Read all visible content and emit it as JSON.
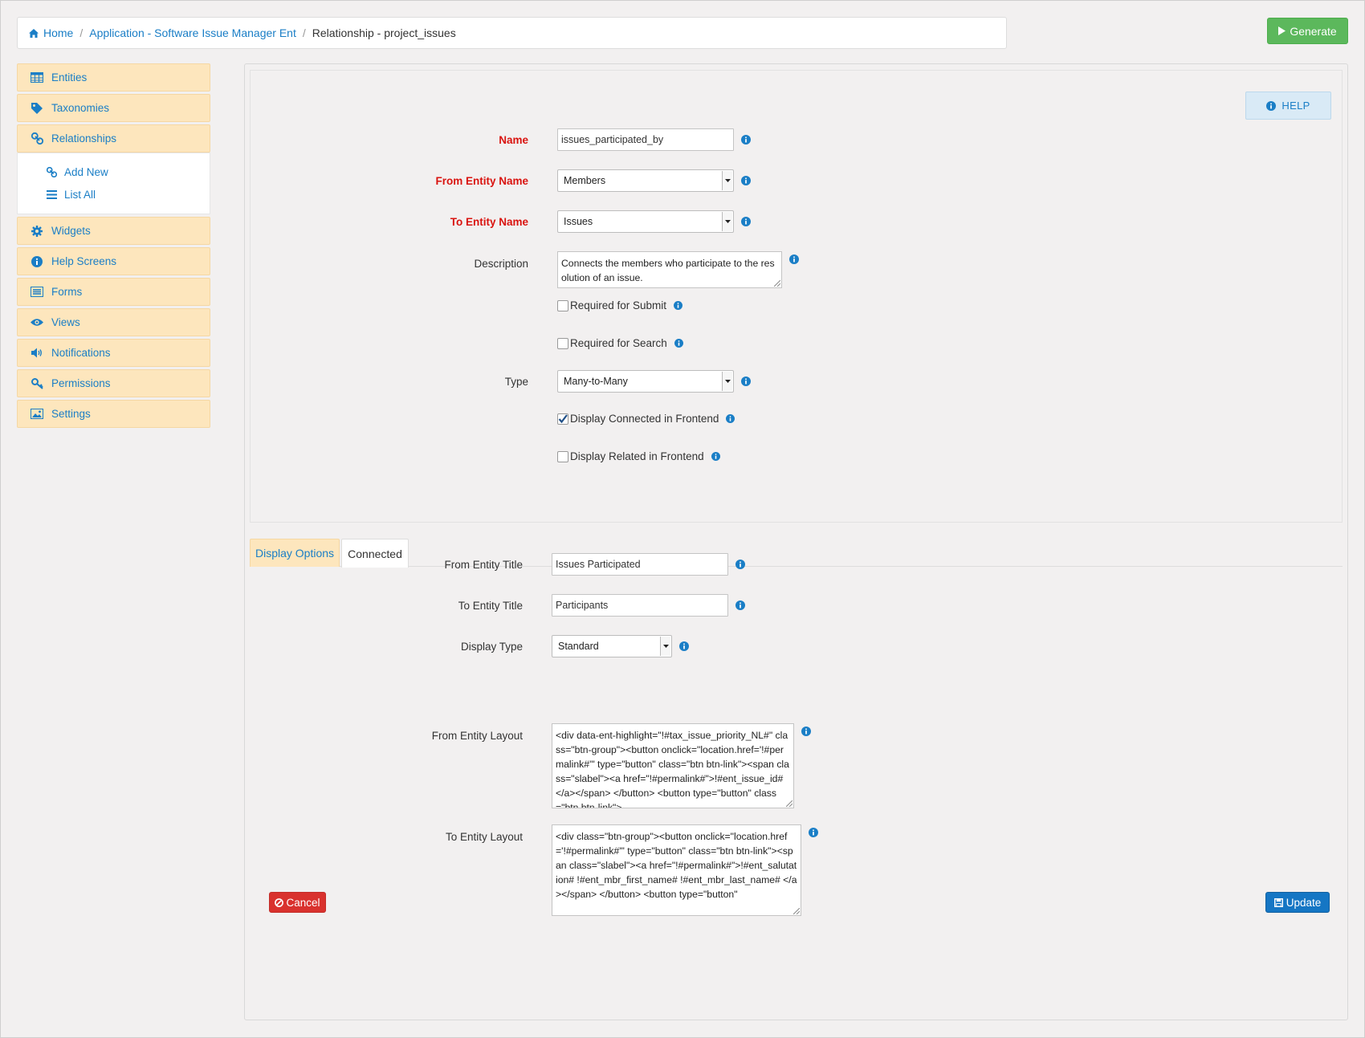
{
  "breadcrumb": {
    "home": "Home",
    "app": "Application - Software Issue Manager Ent",
    "current": "Relationship - project_issues"
  },
  "actions": {
    "generate": "Generate",
    "help": "HELP",
    "cancel": "Cancel",
    "update": "Update"
  },
  "sidebar": {
    "items": [
      {
        "label": "Entities",
        "icon": "table-icon"
      },
      {
        "label": "Taxonomies",
        "icon": "tag-icon"
      },
      {
        "label": "Relationships",
        "icon": "link-icon"
      },
      {
        "label": "Widgets",
        "icon": "gear-icon"
      },
      {
        "label": "Help Screens",
        "icon": "info-icon"
      },
      {
        "label": "Forms",
        "icon": "form-icon"
      },
      {
        "label": "Views",
        "icon": "eye-icon"
      },
      {
        "label": "Notifications",
        "icon": "speaker-icon"
      },
      {
        "label": "Permissions",
        "icon": "key-icon"
      },
      {
        "label": "Settings",
        "icon": "image-icon"
      }
    ],
    "subitems": [
      {
        "label": "Add New",
        "icon": "link-icon"
      },
      {
        "label": "List All",
        "icon": "list-icon"
      }
    ]
  },
  "form": {
    "name": {
      "label": "Name",
      "value": "issues_participated_by"
    },
    "from_entity": {
      "label": "From Entity Name",
      "value": "Members"
    },
    "to_entity": {
      "label": "To Entity Name",
      "value": "Issues"
    },
    "description": {
      "label": "Description",
      "value": "Connects the members who participate to the resolution of an issue."
    },
    "required_submit": {
      "label": "Required for Submit",
      "checked": false
    },
    "required_search": {
      "label": "Required for Search",
      "checked": false
    },
    "type": {
      "label": "Type",
      "value": "Many-to-Many"
    },
    "display_connected": {
      "label": "Display Connected in Frontend",
      "checked": true
    },
    "display_related": {
      "label": "Display Related in Frontend",
      "checked": false
    }
  },
  "tabs": [
    {
      "label": "Display Options",
      "active": false
    },
    {
      "label": "Connected",
      "active": true
    }
  ],
  "connected": {
    "from_title": {
      "label": "From Entity Title",
      "value": "Issues Participated"
    },
    "to_title": {
      "label": "To Entity Title",
      "value": "Participants"
    },
    "display_type": {
      "label": "Display Type",
      "value": "Standard"
    },
    "from_layout": {
      "label": "From Entity Layout",
      "value": "<div data-ent-highlight=\"!#tax_issue_priority_NL#\" class=\"btn-group\"><button onclick=\"location.href='!#permalink#'\" type=\"button\" class=\"btn btn-link\"><span class=\"slabel\"><a href=\"!#permalink#\">!#ent_issue_id#</a></span> </button> <button type=\"button\" class=\"btn btn-link\">"
    },
    "to_layout": {
      "label": "To Entity Layout",
      "value": "<div class=\"btn-group\"><button onclick=\"location.href='!#permalink#'\" type=\"button\" class=\"btn btn-link\"><span class=\"slabel\"><a href=\"!#permalink#\">!#ent_salutation# !#ent_mbr_first_name# !#ent_mbr_last_name# </a></span> </button> <button type=\"button\""
    }
  },
  "colors": {
    "link": "#1a7ec6",
    "required": "#d9130f",
    "nav_bg": "#fde6bd",
    "generate": "#5cb85c",
    "cancel": "#d9322e",
    "update": "#1576c4"
  }
}
